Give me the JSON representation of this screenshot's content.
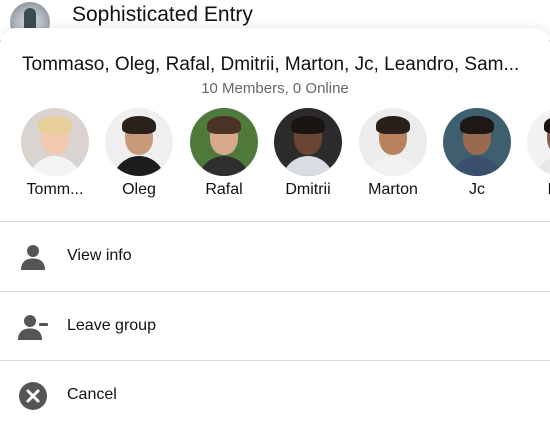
{
  "background": {
    "conversation_title": "Sophisticated Entry"
  },
  "sheet": {
    "group_title": "Tommaso, Oleg, Rafal, Dmitrii, Marton, Jc, Leandro, Sam...",
    "group_subtitle": "10 Members, 0 Online",
    "members": [
      {
        "name": "Tommaso",
        "display": "Tomm...",
        "skin": "#f2c9b0",
        "hair": "#e8cf9a",
        "shirt": "#f4f4f4",
        "bg": "#d9d4cf"
      },
      {
        "name": "Oleg",
        "display": "Oleg",
        "skin": "#c99a7a",
        "hair": "#2a211c",
        "shirt": "#1d1d1d",
        "bg": "#efefef"
      },
      {
        "name": "Rafal",
        "display": "Rafal",
        "skin": "#d9a98c",
        "hair": "#4a3326",
        "shirt": "#2f2f2f",
        "bg": "#4f7a3a"
      },
      {
        "name": "Dmitrii",
        "display": "Dmitrii",
        "skin": "#6b4634",
        "hair": "#1a1412",
        "shirt": "#d9dde3",
        "bg": "#2b2b2b"
      },
      {
        "name": "Marton",
        "display": "Marton",
        "skin": "#b7835f",
        "hair": "#2a1f1a",
        "shirt": "#f1f1f1",
        "bg": "#ececec"
      },
      {
        "name": "Jc",
        "display": "Jc",
        "skin": "#9a6a4e",
        "hair": "#1d1814",
        "shirt": "#3a4f6b",
        "bg": "#3d5f6e"
      },
      {
        "name": "Leandro",
        "display": "Lea",
        "skin": "#8a5a42",
        "hair": "#1a1512",
        "shirt": "#e8e8e8",
        "bg": "#f2f2f2"
      }
    ],
    "actions": [
      {
        "label": "View info",
        "icon": "person-icon"
      },
      {
        "label": "Leave group",
        "icon": "person-remove-icon"
      },
      {
        "label": "Cancel",
        "icon": "cancel-icon"
      }
    ]
  },
  "colors": {
    "icon_gray": "#555555",
    "secondary_text": "#65676b",
    "divider": "#d8d8d8"
  }
}
